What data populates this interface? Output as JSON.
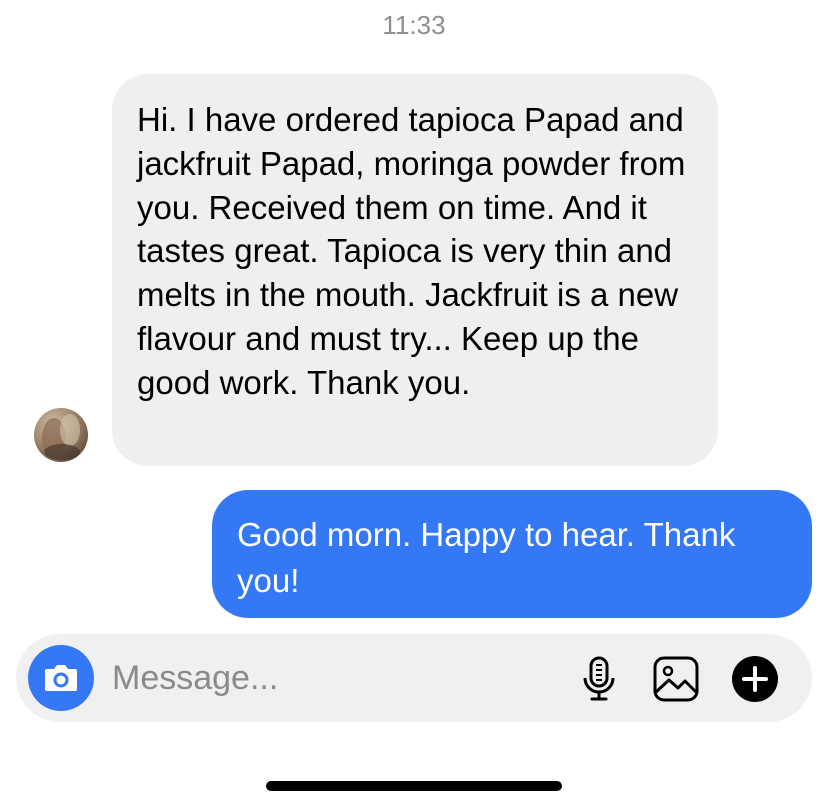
{
  "conversation": {
    "timestamp": "11:33",
    "messages": [
      {
        "direction": "incoming",
        "text": "Hi. I have ordered tapioca Papad and jackfruit Papad, moringa powder from you. Received them on time. And it tastes great. Tapioca is very thin and melts in the mouth. Jackfruit is a new flavour and must try... Keep up the good work. Thank you."
      },
      {
        "direction": "outgoing",
        "text": "Good morn. Happy to hear. Thank you!"
      }
    ]
  },
  "composer": {
    "placeholder": "Message...",
    "icons": {
      "camera": "camera-icon",
      "mic": "microphone-icon",
      "gallery": "image-gallery-icon",
      "plus": "plus-circle-icon"
    }
  },
  "colors": {
    "incoming_bubble": "#efefef",
    "outgoing_bubble": "#3478f6",
    "timestamp": "#8e8e93",
    "composer_background": "#f0f0f0"
  }
}
